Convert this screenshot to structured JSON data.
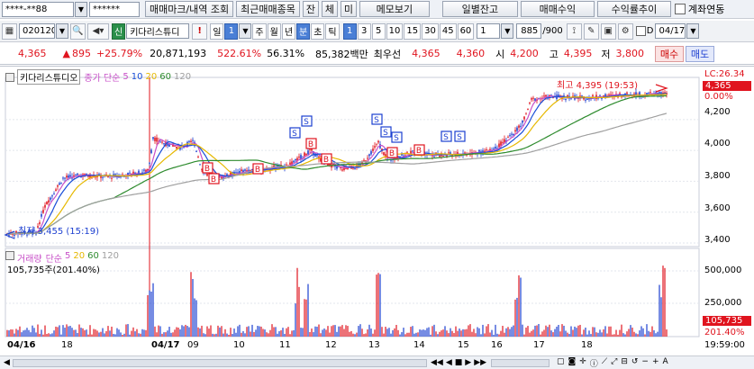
{
  "account": {
    "number": "****-**88",
    "password": "******"
  },
  "toolbar_top": [
    "매매마크/내역 조회",
    "최근매매종목",
    "잔",
    "체",
    "미",
    "메모보기",
    "일별잔고",
    "매매수익",
    "수익률추이"
  ],
  "account_link_label": "계좌연동",
  "stock": {
    "code": "020120",
    "badge": "신",
    "name": "키다리스튜디"
  },
  "periods": [
    "일",
    "1",
    "주",
    "월",
    "년",
    "분",
    "초",
    "틱"
  ],
  "minutes": [
    "1",
    "3",
    "5",
    "10",
    "15",
    "30",
    "45",
    "60"
  ],
  "minute_value": "1",
  "count_display": "885",
  "count_total": "/900",
  "date_value": "04/17",
  "quote": {
    "price": "4,365",
    "change": "895",
    "rate": "+25.79%",
    "volume": "20,871,193",
    "vol_ratio": "522.61%",
    "turnover": "56.31%",
    "amount": "85,382백만",
    "best_label": "최우선",
    "ask": "4,365",
    "bid": "4,360",
    "open_label": "시",
    "open": "4,200",
    "high_label": "고",
    "high": "4,395",
    "low_label": "저",
    "low": "3,800",
    "buy_label": "매수",
    "sell_label": "매도"
  },
  "price_panel": {
    "name": "키다리스튜디오",
    "ma_type": "종가 단순",
    "ma_periods": [
      "5",
      "10",
      "20",
      "60",
      "120"
    ],
    "high_label": "최고 4,395 (19:53)",
    "low_label": "최저 3,455 (15:19)",
    "lc_label": "LC:26.34",
    "current_price": "4,365",
    "pct_label": "0.00%",
    "y_ticks": [
      "4,200",
      "4,000",
      "3,800",
      "3,600",
      "3,400"
    ],
    "marks": {
      "buy": "B",
      "sell": "S"
    }
  },
  "volume_panel": {
    "name": "거래량",
    "ma_type": "단순",
    "ma_periods": [
      "5",
      "20",
      "60",
      "120"
    ],
    "value_label": "105,735주(201.40%)",
    "y_ticks": [
      "500,000",
      "250,000"
    ],
    "current_volume": "105,735",
    "current_pct": "201.40%"
  },
  "x_axis": {
    "labels": [
      "04/16",
      "18",
      "04/17",
      "09",
      "10",
      "11",
      "12",
      "13",
      "14",
      "15",
      "16",
      "17",
      "18"
    ],
    "time": "19:59:00"
  },
  "colors": {
    "ma5": "#c850c8",
    "ma10": "#1a4fd8",
    "ma20": "#e6b800",
    "ma60": "#2e8b2e",
    "ma120": "#a0a0a0",
    "up": "#e0141e",
    "down": "#1c3fd0"
  }
}
